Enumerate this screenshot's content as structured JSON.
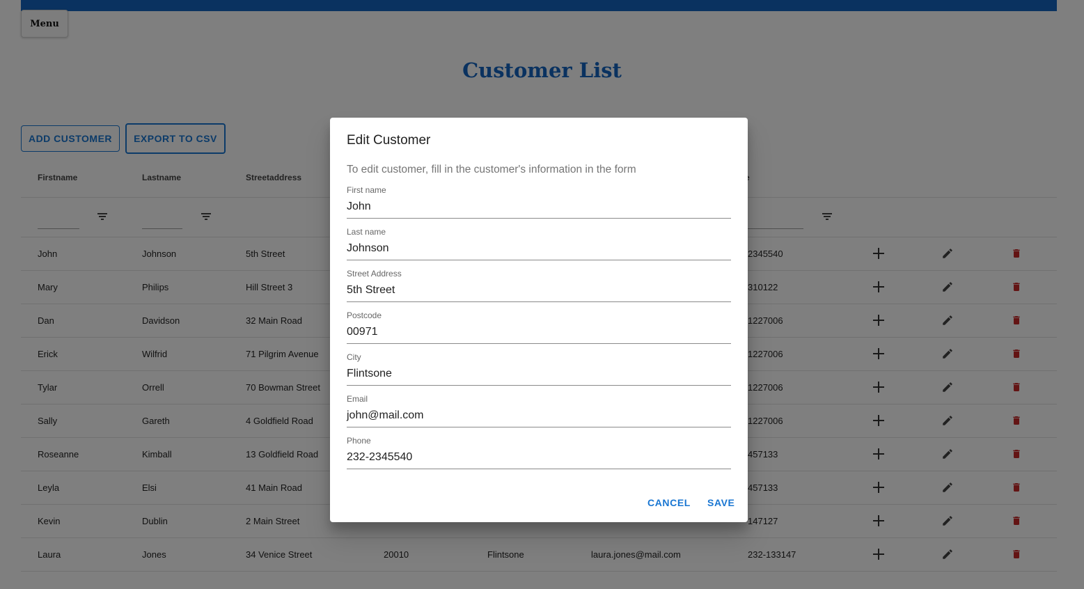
{
  "nav": {
    "menu_label": "Menu"
  },
  "page": {
    "title": "Customer List"
  },
  "toolbar": {
    "add_label": "ADD CUSTOMER",
    "export_label": "EXPORT TO CSV"
  },
  "table": {
    "headers": [
      "Firstname",
      "Lastname",
      "Streetaddress",
      "",
      "",
      "",
      "e"
    ],
    "rows": [
      {
        "firstname": "John",
        "lastname": "Johnson",
        "street": "5th Street",
        "postcode": "",
        "city": "",
        "email": "",
        "phone": "2345540"
      },
      {
        "firstname": "Mary",
        "lastname": "Philips",
        "street": "Hill Street 3",
        "postcode": "",
        "city": "",
        "email": "",
        "phone": "310122"
      },
      {
        "firstname": "Dan",
        "lastname": "Davidson",
        "street": "32 Main Road",
        "postcode": "",
        "city": "",
        "email": "",
        "phone": "1227006"
      },
      {
        "firstname": "Erick",
        "lastname": "Wilfrid",
        "street": "71 Pilgrim Avenue",
        "postcode": "",
        "city": "",
        "email": "",
        "phone": "1227006"
      },
      {
        "firstname": "Tylar",
        "lastname": "Orrell",
        "street": "70 Bowman Street",
        "postcode": "",
        "city": "",
        "email": "",
        "phone": "1227006"
      },
      {
        "firstname": "Sally",
        "lastname": "Gareth",
        "street": "4 Goldfield Road",
        "postcode": "",
        "city": "",
        "email": "",
        "phone": "1227006"
      },
      {
        "firstname": "Roseanne",
        "lastname": "Kimball",
        "street": "13 Goldfield Road",
        "postcode": "",
        "city": "",
        "email": "",
        "phone": "457133"
      },
      {
        "firstname": "Leyla",
        "lastname": "Elsi",
        "street": "41 Main Road",
        "postcode": "",
        "city": "",
        "email": "",
        "phone": "457133"
      },
      {
        "firstname": "Kevin",
        "lastname": "Dublin",
        "street": "2 Main Street",
        "postcode": "",
        "city": "",
        "email": "",
        "phone": "147127"
      },
      {
        "firstname": "Laura",
        "lastname": "Jones",
        "street": "34 Venice Street",
        "postcode": "20010",
        "city": "Flintsone",
        "email": "laura.jones@mail.com",
        "phone": "232-133147"
      }
    ]
  },
  "dialog": {
    "title": "Edit Customer",
    "description": "To edit customer, fill in the customer's information in the form",
    "fields": [
      {
        "label": "First name",
        "value": "John"
      },
      {
        "label": "Last name",
        "value": "Johnson"
      },
      {
        "label": "Street Address",
        "value": "5th Street"
      },
      {
        "label": "Postcode",
        "value": "00971"
      },
      {
        "label": "City",
        "value": "Flintsone"
      },
      {
        "label": "Email",
        "value": "john@mail.com"
      },
      {
        "label": "Phone",
        "value": "232-2345540"
      }
    ],
    "cancel_label": "CANCEL",
    "save_label": "SAVE"
  },
  "colors": {
    "primary": "#1976d2",
    "topbar": "#1565c0",
    "delete": "#c62828",
    "icon": "#444444"
  },
  "icons": {
    "add": "plus-icon",
    "edit": "pencil-icon",
    "delete": "trash-icon",
    "filter": "filter-icon"
  }
}
